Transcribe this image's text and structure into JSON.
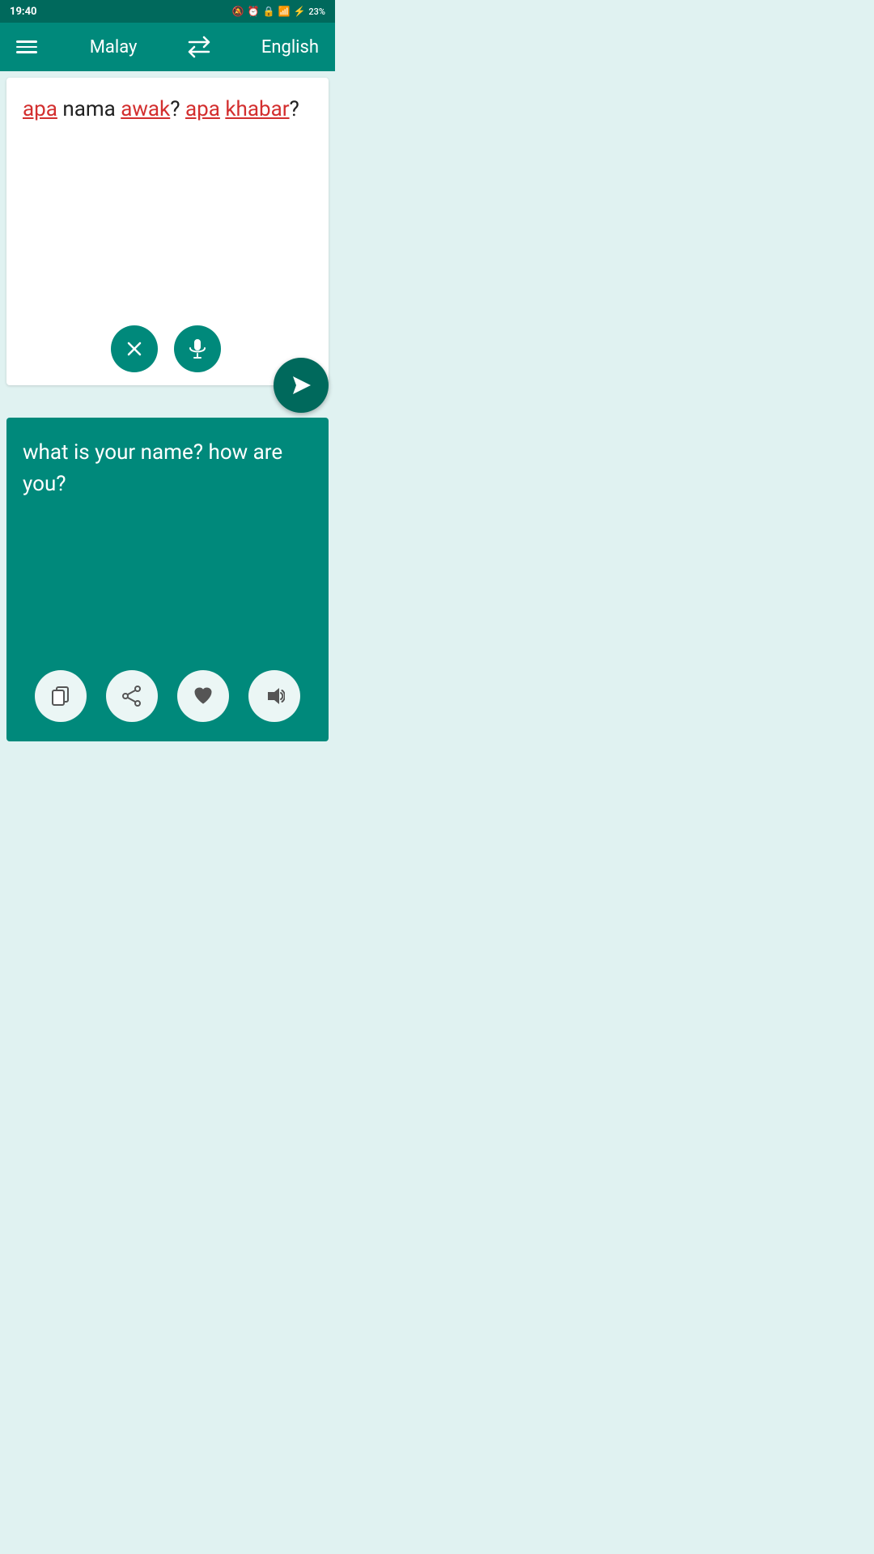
{
  "statusBar": {
    "time": "19:40",
    "batteryPercent": "23%"
  },
  "navbar": {
    "sourceLang": "Malay",
    "targetLang": "English"
  },
  "inputPanel": {
    "text_parts": [
      {
        "word": "apa",
        "style": "red"
      },
      {
        "word": " nama ",
        "style": "dark"
      },
      {
        "word": "awak",
        "style": "red"
      },
      {
        "word": "? ",
        "style": "dark"
      },
      {
        "word": "apa",
        "style": "red"
      },
      {
        "word": " ",
        "style": "dark"
      },
      {
        "word": "khabar",
        "style": "red"
      },
      {
        "word": "?",
        "style": "dark"
      }
    ],
    "clearLabel": "×",
    "micLabel": "mic"
  },
  "outputPanel": {
    "text": "what is your name? how are you?"
  },
  "actions": {
    "copy": "copy",
    "share": "share",
    "favorite": "favorite",
    "speak": "speak"
  }
}
